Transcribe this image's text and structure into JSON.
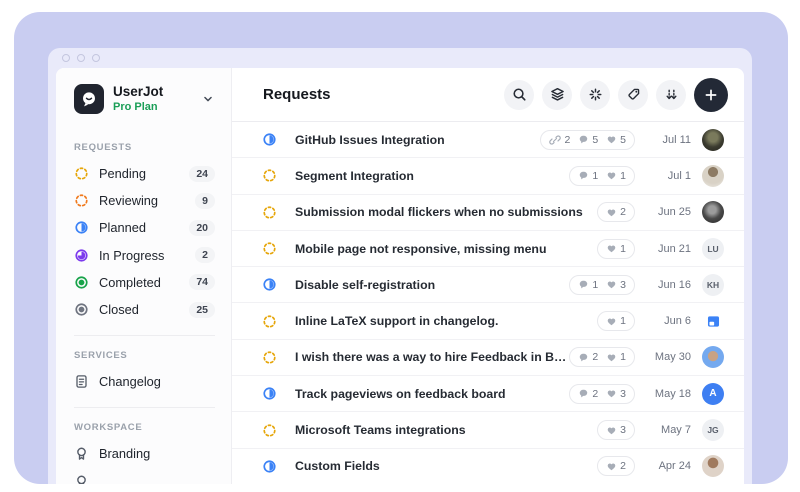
{
  "app": {
    "name": "UserJot",
    "plan": "Pro Plan"
  },
  "sidebar": {
    "sections": [
      {
        "label": "REQUESTS",
        "items": [
          {
            "label": "Pending",
            "count": "24",
            "status": "pending"
          },
          {
            "label": "Reviewing",
            "count": "9",
            "status": "reviewing"
          },
          {
            "label": "Planned",
            "count": "20",
            "status": "planned"
          },
          {
            "label": "In Progress",
            "count": "2",
            "status": "in-progress"
          },
          {
            "label": "Completed",
            "count": "74",
            "status": "completed"
          },
          {
            "label": "Closed",
            "count": "25",
            "status": "closed"
          }
        ]
      },
      {
        "label": "SERVICES",
        "items": [
          {
            "label": "Changelog",
            "icon": "changelog-icon"
          }
        ]
      },
      {
        "label": "WORKSPACE",
        "items": [
          {
            "label": "Branding",
            "icon": "branding-icon"
          }
        ]
      }
    ]
  },
  "header": {
    "title": "Requests",
    "buttons": [
      "search-icon",
      "layers-icon",
      "status-filter-icon",
      "tag-icon",
      "sort-icon",
      "add-button"
    ]
  },
  "rows": [
    {
      "status": "planned",
      "title": "GitHub Issues Integration",
      "links": "2",
      "comments": "5",
      "likes": "5",
      "date": "Jul 11",
      "avatar": "photo"
    },
    {
      "status": "pending",
      "title": "Segment Integration",
      "comments": "1",
      "likes": "1",
      "date": "Jul 1",
      "avatar": "photo"
    },
    {
      "status": "pending",
      "title": "Submission modal flickers when no submissions",
      "likes": "2",
      "date": "Jun 25",
      "avatar": "photo"
    },
    {
      "status": "pending",
      "title": "Mobile page not responsive, missing menu",
      "likes": "1",
      "date": "Jun 21",
      "initials": "LU"
    },
    {
      "status": "planned",
      "title": "Disable self-registration",
      "comments": "1",
      "likes": "3",
      "date": "Jun 16",
      "initials": "KH"
    },
    {
      "status": "pending",
      "title": "Inline LaTeX support in changelog.",
      "likes": "1",
      "date": "Jun 6",
      "avatar": "image-icon"
    },
    {
      "status": "pending",
      "title": "I wish there was a way to hire Feedback in Board",
      "comments": "2",
      "likes": "1",
      "date": "May 30",
      "avatar": "photo"
    },
    {
      "status": "planned",
      "title": "Track pageviews on feedback board",
      "comments": "2",
      "likes": "3",
      "date": "May 18",
      "initials": "A"
    },
    {
      "status": "pending",
      "title": "Microsoft Teams integrations",
      "likes": "3",
      "date": "May 7",
      "initials": "JG"
    },
    {
      "status": "planned",
      "title": "Custom Fields",
      "likes": "2",
      "date": "Apr 24",
      "avatar": "photo"
    }
  ],
  "colors": {
    "panel_lavender": "#c9cdf1",
    "titlebar": "#e9eafa",
    "plan_green": "#1a9e57",
    "pending": "#e6a60a",
    "reviewing": "#f07a1d",
    "planned": "#3b82f6",
    "in_progress": "#7c3aed",
    "completed": "#18a34a",
    "closed": "#6f7480",
    "add_button": "#232936"
  }
}
